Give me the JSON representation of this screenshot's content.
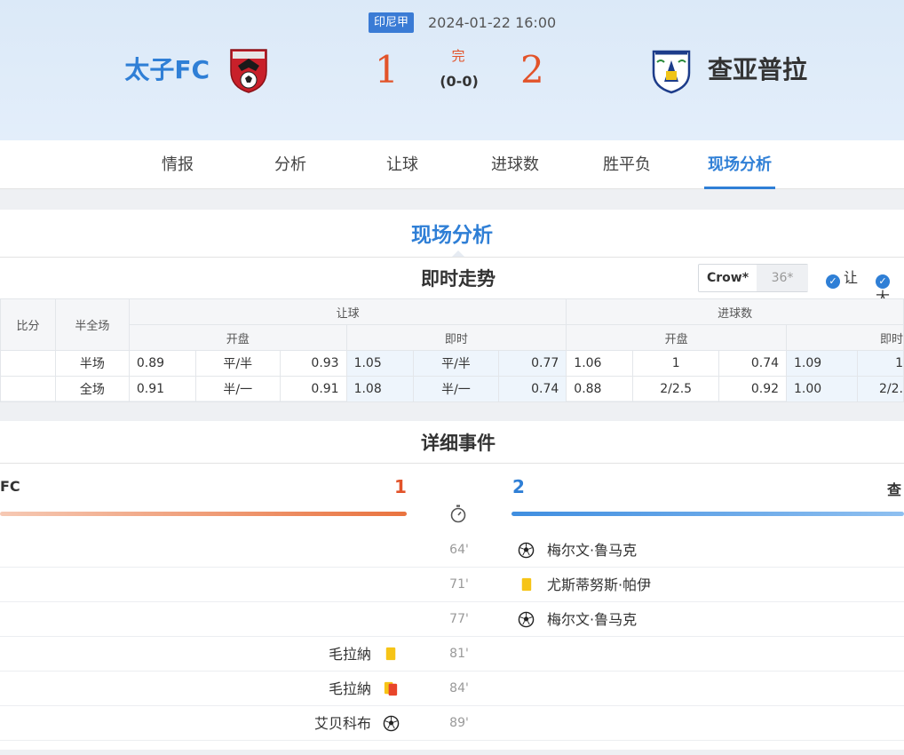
{
  "header": {
    "league": "印尼甲",
    "datetime": "2024-01-22 16:00",
    "home_team": "太子FC",
    "away_team": "查亚普拉",
    "home_score": "1",
    "away_score": "2",
    "status": "完",
    "half_score": "(0-0)",
    "home_logo_icon": "shield-logo-red-icon",
    "away_logo_icon": "shield-logo-blue-icon",
    "colors": {
      "accent": "#2f7fd6",
      "score": "#e2532a"
    }
  },
  "tabs": [
    {
      "label": "情报"
    },
    {
      "label": "分析"
    },
    {
      "label": "让球"
    },
    {
      "label": "进球数"
    },
    {
      "label": "胜平负"
    },
    {
      "label": "现场分析",
      "active": true
    }
  ],
  "panel": {
    "title": "现场分析",
    "trend_title": "即时走势",
    "crow_label": "Crow*",
    "crow_alt": "36*",
    "check1": "让",
    "check2": "大"
  },
  "odds_table": {
    "col_score": "比分",
    "col_half": "半全场",
    "group_handicap": "让球",
    "group_goals": "进球数",
    "sub_open": "开盘",
    "sub_live": "即时",
    "sub_live_cut": "即时",
    "rows": [
      {
        "label": "半场",
        "hc_open": [
          "0.89",
          "平/半",
          "0.93"
        ],
        "hc_live": [
          "1.05",
          "平/半",
          "0.77"
        ],
        "goal_open": [
          "1.06",
          "1",
          "0.74"
        ],
        "goal_live": [
          "1.09",
          "1"
        ]
      },
      {
        "label": "全场",
        "hc_open": [
          "0.91",
          "半/一",
          "0.91"
        ],
        "hc_live": [
          "1.08",
          "半/一",
          "0.74"
        ],
        "goal_open": [
          "0.88",
          "2/2.5",
          "0.92"
        ],
        "goal_live": [
          "1.00",
          "2/2."
        ]
      }
    ]
  },
  "events": {
    "title": "详细事件",
    "home_team_cut": "FC",
    "home_goals": "1",
    "away_goals": "2",
    "away_team_cut": "查",
    "rows": [
      {
        "minute": "64'",
        "side": "away",
        "player": "梅尔文·鲁马克",
        "icon": "soccer-ball-icon"
      },
      {
        "minute": "71'",
        "side": "away",
        "player": "尤斯蒂努斯·帕伊",
        "icon": "yellow-card-icon"
      },
      {
        "minute": "77'",
        "side": "away",
        "player": "梅尔文·鲁马克",
        "icon": "soccer-ball-icon"
      },
      {
        "minute": "81'",
        "side": "home",
        "player": "毛拉納",
        "icon": "yellow-card-icon"
      },
      {
        "minute": "84'",
        "side": "home",
        "player": "毛拉納",
        "icon": "second-yellow-red-card-icon"
      },
      {
        "minute": "89'",
        "side": "home",
        "player": "艾贝科布",
        "icon": "soccer-ball-icon"
      }
    ]
  }
}
